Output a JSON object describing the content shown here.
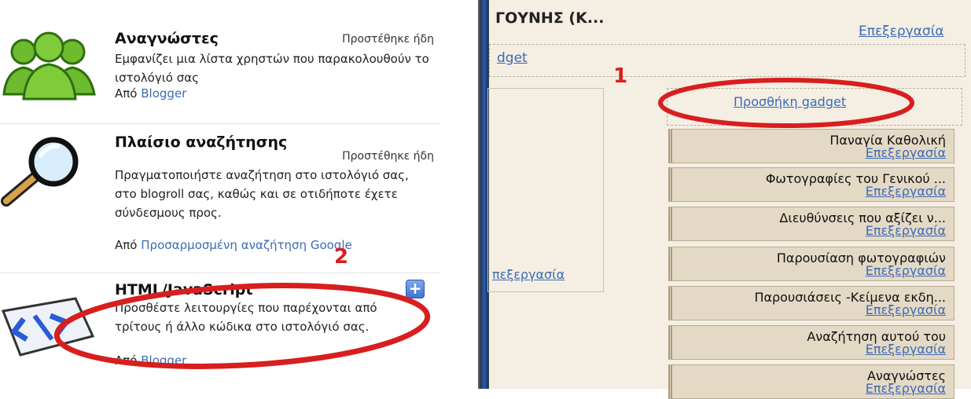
{
  "left_panel": {
    "gadgets": [
      {
        "title": "Αναγνώστες",
        "status": "Προστέθηκε ήδη",
        "description": "Εμφανίζει μια λίστα χρηστών που παρακολουθούν το ιστολόγιό σας",
        "by_prefix": "Από",
        "by_link": "Blogger",
        "icon": "followers-icon"
      },
      {
        "title": "Πλαίσιο αναζήτησης",
        "status": "Προστέθηκε ήδη",
        "description": "Πραγματοποιήστε αναζήτηση στο ιστολόγιό σας, στο blogroll σας, καθώς και σε οτιδήποτε έχετε σύνδεσμους προς.",
        "by_prefix": "Από",
        "by_link": "Προσαρμοσμένη αναζήτηση Google",
        "icon": "magnifier-icon"
      },
      {
        "title": "HTML/JavaScript",
        "description": "Προσθέστε λειτουργίες που παρέχονται από τρίτους ή άλλο κώδικα στο ιστολόγιό σας.",
        "by_prefix": "Από",
        "by_link": "Blogger",
        "add_label": "+",
        "icon": "html-code-icon"
      }
    ]
  },
  "right_panel": {
    "header_title": "ΓΟΥΝΗΣ (Κ...",
    "header_edit": "Επεξεργασία",
    "partial_link": "dget",
    "add_gadget": "Προσθήκη gadget",
    "left_edit": "πεξεργασία",
    "widgets": [
      {
        "title": "Παναγία Καθολική",
        "edit": "Επεξεργασία"
      },
      {
        "title": "Φωτογραφίες του Γενικού ...",
        "edit": "Επεξεργασία"
      },
      {
        "title": "Διευθύνσεις που αξίζει ν...",
        "edit": "Επεξεργασία"
      },
      {
        "title": "Παρουσίαση φωτογραφιών",
        "edit": "Επεξεργασία"
      },
      {
        "title": "Παρουσιάσεις -Κείμενα εκδη...",
        "edit": "Επεξεργασία"
      },
      {
        "title": "Αναζήτηση αυτού του",
        "edit": "Επεξεργασία"
      },
      {
        "title": "Αναγνώστες",
        "edit": "Επεξεργασία"
      }
    ]
  },
  "annotations": {
    "step1": "1",
    "step2": "2",
    "circle_color": "#d81e1e"
  },
  "colors": {
    "link": "#3d6bb6",
    "panel_bg": "#f4eee3",
    "widget_bg": "#e4d9c5"
  }
}
